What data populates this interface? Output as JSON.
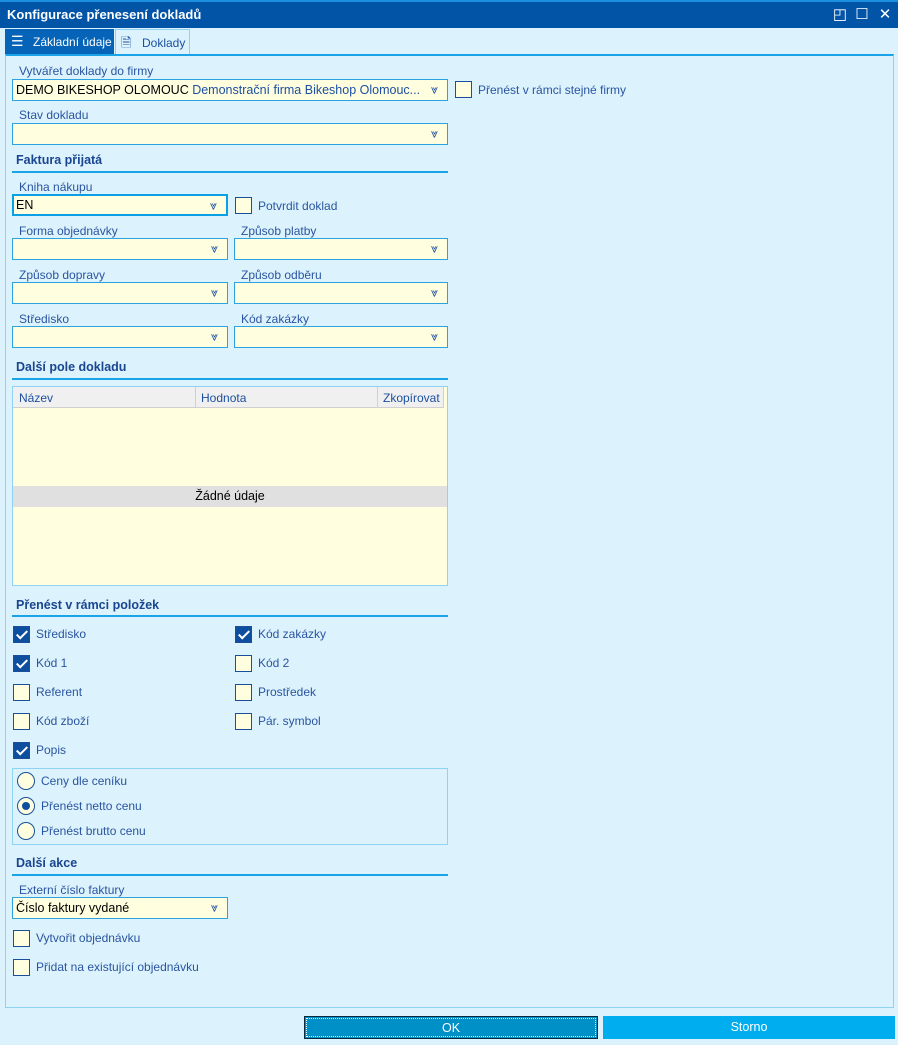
{
  "window": {
    "title": "Konfigurace přenesení dokladů"
  },
  "tabs": [
    {
      "label": "Základní údaje",
      "icon": "list-icon"
    },
    {
      "label": "Doklady",
      "icon": "document-gear-icon",
      "active": true
    }
  ],
  "firma": {
    "label": "Vytvářet doklady do firmy",
    "code": "DEMO BIKESHOP OLOMOUC",
    "name": "Demonstrační firma Bikeshop Olomouc..."
  },
  "same_firm": {
    "label": "Přenést v rámci stejné firmy",
    "checked": false
  },
  "stav": {
    "label": "Stav dokladu",
    "value": ""
  },
  "faktura": {
    "heading": "Faktura přijatá",
    "kniha": {
      "label": "Kniha nákupu",
      "value": "EN"
    },
    "potvrdit": {
      "label": "Potvrdit doklad",
      "checked": false
    },
    "forma": {
      "label": "Forma objednávky",
      "value": ""
    },
    "platba": {
      "label": "Způsob platby",
      "value": ""
    },
    "doprava": {
      "label": "Způsob dopravy",
      "value": ""
    },
    "odber": {
      "label": "Způsob odběru",
      "value": ""
    },
    "stredisko": {
      "label": "Středisko",
      "value": ""
    },
    "zakazka": {
      "label": "Kód zakázky",
      "value": ""
    }
  },
  "dalsi_pole": {
    "heading": "Další pole dokladu",
    "columns": [
      "Název",
      "Hodnota",
      "Zkopírovat"
    ],
    "empty": "Žádné údaje"
  },
  "polozky": {
    "heading": "Přenést v rámci položek",
    "items": [
      {
        "label": "Středisko",
        "checked": true
      },
      {
        "label": "Kód zakázky",
        "checked": true
      },
      {
        "label": "Kód 1",
        "checked": true
      },
      {
        "label": "Kód 2",
        "checked": false
      },
      {
        "label": "Referent",
        "checked": false
      },
      {
        "label": "Prostředek",
        "checked": false
      },
      {
        "label": "Kód zboží",
        "checked": false
      },
      {
        "label": "Pár. symbol",
        "checked": false
      },
      {
        "label": "Popis",
        "checked": true
      }
    ],
    "prices": [
      {
        "label": "Ceny dle ceníku",
        "selected": false
      },
      {
        "label": "Přenést netto cenu",
        "selected": true
      },
      {
        "label": "Přenést brutto cenu",
        "selected": false
      }
    ]
  },
  "akce": {
    "heading": "Další akce",
    "ext": {
      "label": "Externí číslo faktury",
      "value": "Číslo faktury vydané"
    },
    "items": [
      {
        "label": "Vytvořit objednávku",
        "checked": false
      },
      {
        "label": "Přidat na existující objednávku",
        "checked": false
      }
    ]
  },
  "buttons": {
    "ok": "OK",
    "storno": "Storno"
  },
  "colors": {
    "titlebar": "#0254a6",
    "background": "#dcf3fd",
    "field": "#ffffe0",
    "accent": "#1ba3e8",
    "ok": "#0090c8",
    "storno": "#00adef"
  }
}
